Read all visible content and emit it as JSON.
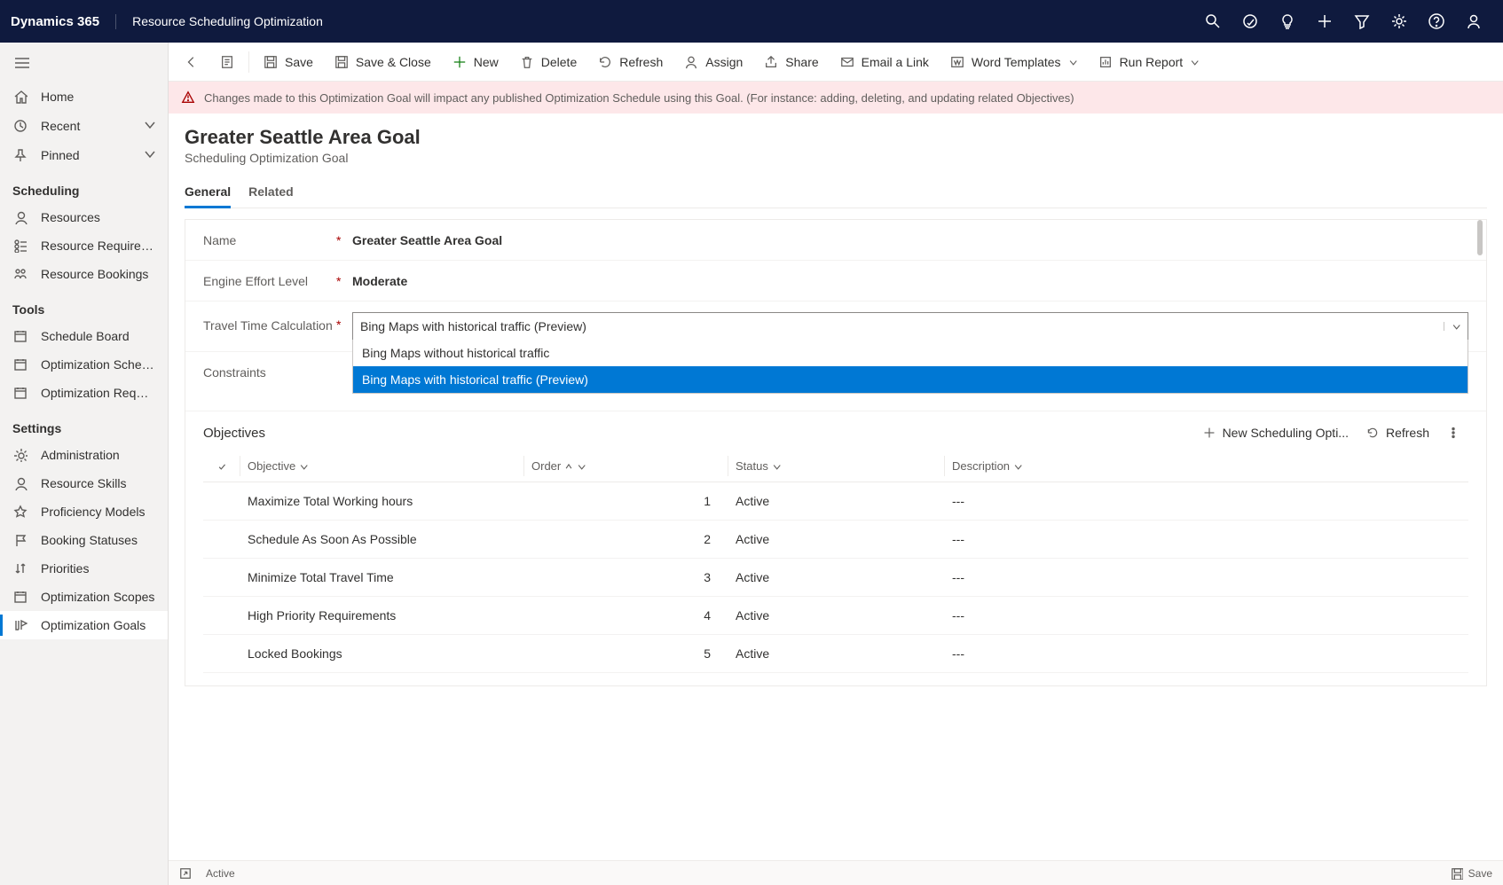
{
  "topbar": {
    "brand": "Dynamics 365",
    "app_name": "Resource Scheduling Optimization"
  },
  "sidenav": {
    "primary": [
      {
        "label": "Home",
        "icon": "home"
      },
      {
        "label": "Recent",
        "icon": "clock",
        "chevron": true
      },
      {
        "label": "Pinned",
        "icon": "pin",
        "chevron": true
      }
    ],
    "groups": [
      {
        "title": "Scheduling",
        "items": [
          {
            "label": "Resources",
            "icon": "resource"
          },
          {
            "label": "Resource Requireme...",
            "icon": "reqs"
          },
          {
            "label": "Resource Bookings",
            "icon": "bookings"
          }
        ]
      },
      {
        "title": "Tools",
        "items": [
          {
            "label": "Schedule Board",
            "icon": "calendar"
          },
          {
            "label": "Optimization Schedu...",
            "icon": "calendar"
          },
          {
            "label": "Optimization Requests",
            "icon": "calendar"
          }
        ]
      },
      {
        "title": "Settings",
        "items": [
          {
            "label": "Administration",
            "icon": "gear"
          },
          {
            "label": "Resource Skills",
            "icon": "skills"
          },
          {
            "label": "Proficiency Models",
            "icon": "star"
          },
          {
            "label": "Booking Statuses",
            "icon": "flag"
          },
          {
            "label": "Priorities",
            "icon": "sort"
          },
          {
            "label": "Optimization Scopes",
            "icon": "scope"
          },
          {
            "label": "Optimization Goals",
            "icon": "goal",
            "active": true
          }
        ]
      }
    ]
  },
  "cmdbar": {
    "save": "Save",
    "save_close": "Save & Close",
    "new": "New",
    "delete": "Delete",
    "refresh": "Refresh",
    "assign": "Assign",
    "share": "Share",
    "email": "Email a Link",
    "word": "Word Templates",
    "run_report": "Run Report"
  },
  "banner": {
    "text": "Changes made to this Optimization Goal will impact any published Optimization Schedule using this Goal. (For instance: adding, deleting, and updating related Objectives)"
  },
  "page": {
    "title": "Greater Seattle Area Goal",
    "subtitle": "Scheduling Optimization Goal"
  },
  "tabs": {
    "general": "General",
    "related": "Related"
  },
  "form": {
    "name_label": "Name",
    "name_value": "Greater Seattle Area Goal",
    "effort_label": "Engine Effort Level",
    "effort_value": "Moderate",
    "travel_label": "Travel Time Calculation",
    "travel_selected": "Bing Maps with historical traffic (Preview)",
    "travel_options": [
      "Bing Maps without historical traffic",
      "Bing Maps with historical traffic (Preview)"
    ],
    "constraints_label": "Constraints"
  },
  "objectives": {
    "title": "Objectives",
    "new_btn": "New Scheduling Opti...",
    "refresh_btn": "Refresh",
    "cols": {
      "objective": "Objective",
      "order": "Order",
      "status": "Status",
      "description": "Description"
    },
    "rows": [
      {
        "objective": "Maximize Total Working hours",
        "order": "1",
        "status": "Active",
        "description": "---"
      },
      {
        "objective": "Schedule As Soon As Possible",
        "order": "2",
        "status": "Active",
        "description": "---"
      },
      {
        "objective": "Minimize Total Travel Time",
        "order": "3",
        "status": "Active",
        "description": "---"
      },
      {
        "objective": "High Priority Requirements",
        "order": "4",
        "status": "Active",
        "description": "---"
      },
      {
        "objective": "Locked Bookings",
        "order": "5",
        "status": "Active",
        "description": "---"
      }
    ]
  },
  "statusbar": {
    "state": "Active",
    "save": "Save"
  }
}
